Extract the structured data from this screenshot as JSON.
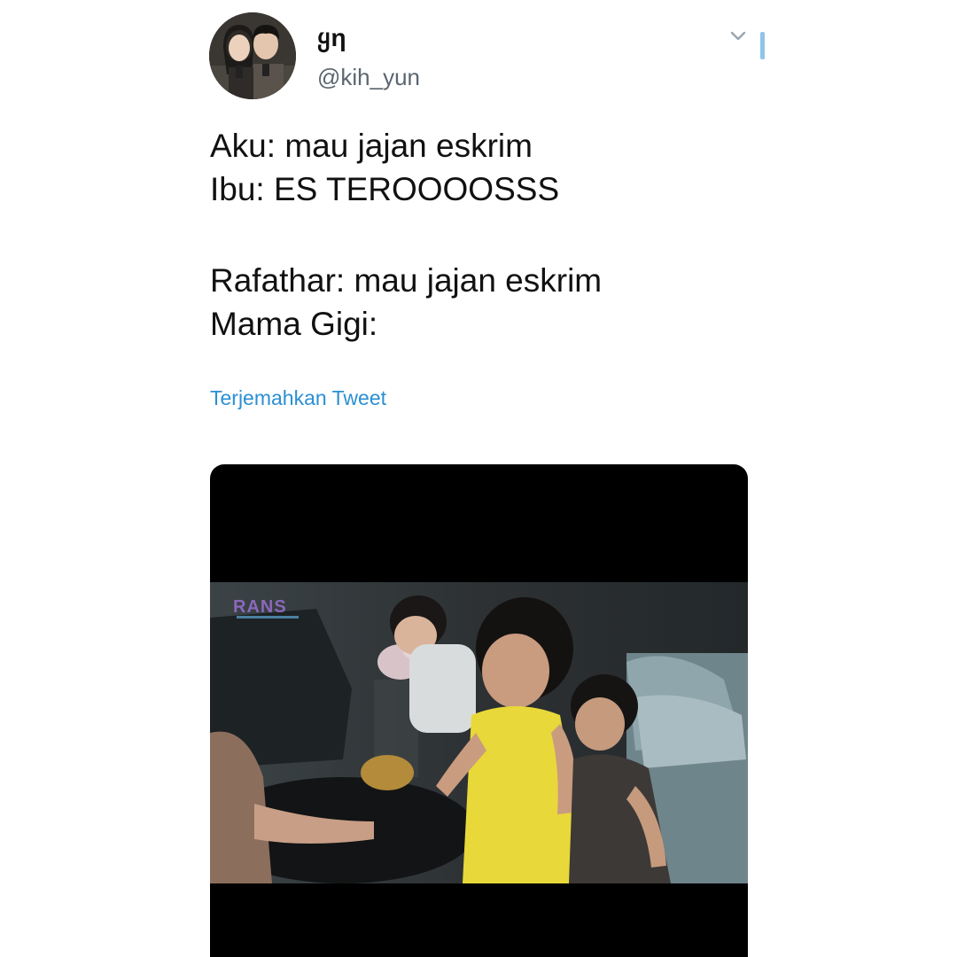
{
  "author": {
    "display_name": "ყη",
    "handle": "@kih_yun",
    "avatar": "two-people-mirror-selfie-avatar"
  },
  "tweet": {
    "lines": [
      "Aku: mau jajan eskrim",
      "Ibu: ES TEROOOOSSS",
      "Rafathar: mau jajan eskrim",
      "Mama Gigi:"
    ],
    "translate_label": "Terjemahkan Tweet"
  },
  "media": {
    "type": "video",
    "watermark": "RANS"
  },
  "icons": {
    "menu": "chevron-down-icon"
  },
  "colors": {
    "link": "#2b8fd3",
    "handle": "#5b6670",
    "text": "#111111",
    "scroll_indicator": "#8fc4ea",
    "media_background": "#000000"
  }
}
